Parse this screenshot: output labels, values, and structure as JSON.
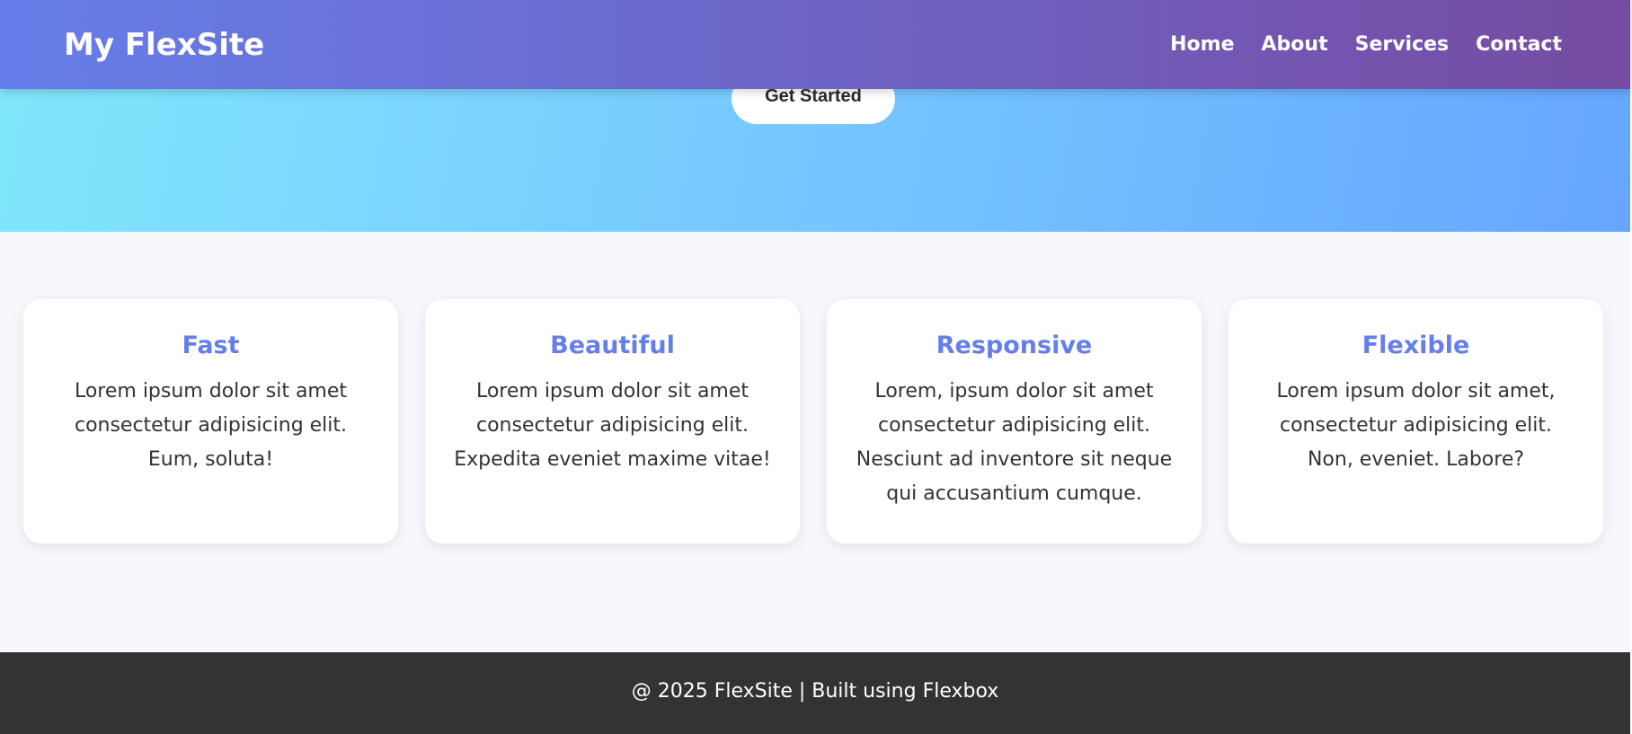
{
  "header": {
    "logo": "My FlexSite",
    "nav": [
      {
        "label": "Home"
      },
      {
        "label": "About"
      },
      {
        "label": "Services"
      },
      {
        "label": "Contact"
      }
    ]
  },
  "hero": {
    "cta_label": "Get Started"
  },
  "features": [
    {
      "title": "Fast",
      "text": "Lorem ipsum dolor sit amet consectetur adipisicing elit. Eum, soluta!"
    },
    {
      "title": "Beautiful",
      "text": "Lorem ipsum dolor sit amet consectetur adipisicing elit. Expedita eveniet maxime vitae!"
    },
    {
      "title": "Responsive",
      "text": "Lorem, ipsum dolor sit amet consectetur adipisicing elit. Nesciunt ad inventore sit neque qui accusantium cumque."
    },
    {
      "title": "Flexible",
      "text": "Lorem ipsum dolor sit amet, consectetur adipisicing elit. Non, eveniet. Labore?"
    }
  ],
  "footer": {
    "text": "@ 2025 FlexSite | Built using Flexbox"
  },
  "colors": {
    "header_gradient_start": "#667eea",
    "header_gradient_end": "#764ba2",
    "hero_gradient_start": "#81e7fc",
    "hero_gradient_end": "#66a6ff",
    "card_title": "#667eea",
    "footer_bg": "#333333",
    "page_bg": "#f7f8fc"
  }
}
